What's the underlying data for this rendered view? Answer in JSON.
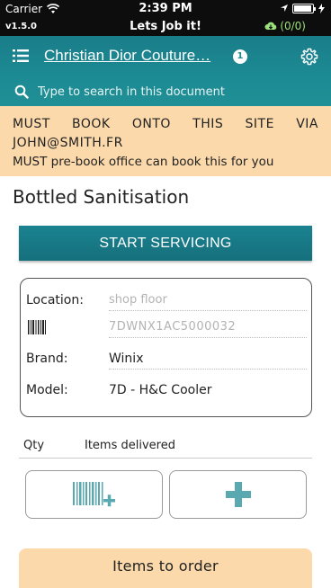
{
  "status_bar": {
    "carrier": "Carrier",
    "time": "2:39 PM",
    "icons": [
      "wifi-icon",
      "location-arrow-icon",
      "battery-icon",
      "charging-icon"
    ]
  },
  "app_bar": {
    "version": "v1.5.0",
    "title": "Lets Job it!",
    "sync_count": "(0/0)",
    "sync_icon": "cloud-download-icon"
  },
  "header": {
    "menu_icon": "list-menu-icon",
    "doc_title": "Christian Dior Couture…",
    "notification_count": "1",
    "settings_icon": "gear-icon",
    "search_placeholder": "Type to search in this document",
    "accent_color": "#1c8a92"
  },
  "notice": {
    "line1_words": [
      "MUST",
      "BOOK",
      "ONTO",
      "THIS",
      "SITE",
      "VIA"
    ],
    "line2": "JOHN@SMITH.FR",
    "line3": "MUST pre-book office can book this for you",
    "background_color": "#fbd9ab"
  },
  "task": {
    "title": "Bottled Sanitisation",
    "start_button": "START SERVICING"
  },
  "details": {
    "location_label": "Location:",
    "location_placeholder": "shop floor",
    "barcode_placeholder": "7DWNX1AC5000032",
    "brand_label": "Brand:",
    "brand_value": "Winix",
    "model_label": "Model:",
    "model_value": "7D - H&C Cooler"
  },
  "items": {
    "qty_header": "Qty",
    "items_header": "Items delivered",
    "scan_button_icon": "barcode-add-icon",
    "add_button_icon": "plus-icon"
  },
  "order": {
    "title": "Items to order"
  }
}
